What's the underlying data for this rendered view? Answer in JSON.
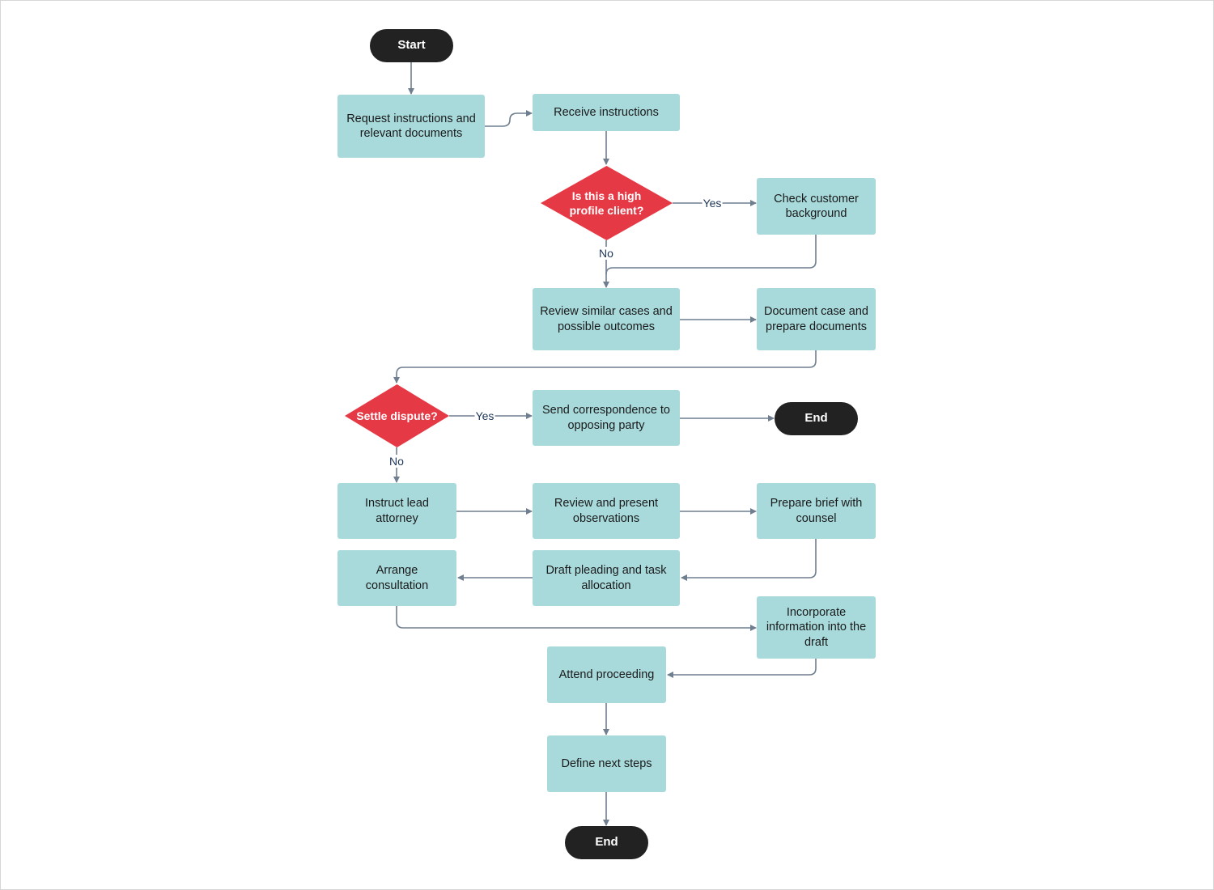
{
  "colors": {
    "process": "#a8dadc",
    "decision": "#e63946",
    "terminal": "#222222",
    "connector": "#6f7f8f",
    "label": "#1d3557"
  },
  "nodes": {
    "start": "Start",
    "request": "Request instructions and relevant documents",
    "receive": "Receive instructions",
    "high_profile": "Is this a high profile client?",
    "check_background": "Check customer background",
    "review_cases": "Review similar cases and possible outcomes",
    "document_case": "Document case and prepare documents",
    "settle": "Settle dispute?",
    "send_correspondence": "Send correspondence to opposing party",
    "end1": "End",
    "instruct_attorney": "Instruct lead attorney",
    "review_present": "Review and present observations",
    "prepare_brief": "Prepare brief with counsel",
    "arrange_consultation": "Arrange consultation",
    "draft_pleading": "Draft pleading and task allocation",
    "incorporate": "Incorporate information into the draft",
    "attend": "Attend proceeding",
    "define_steps": "Define next steps",
    "end2": "End"
  },
  "edge_labels": {
    "hp_yes": "Yes",
    "hp_no": "No",
    "settle_yes": "Yes",
    "settle_no": "No"
  }
}
